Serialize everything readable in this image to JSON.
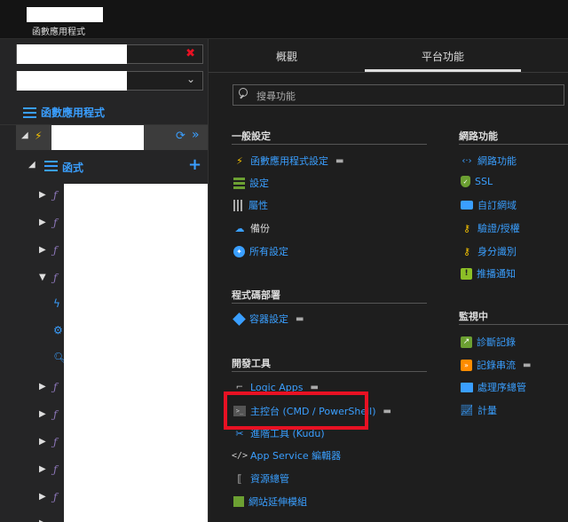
{
  "topbar": {
    "subtitle": "函數應用程式"
  },
  "left": {
    "title": "函數應用程式",
    "functions_label": "函式",
    "x_icon": "close-icon",
    "chevron": "chevron-down-icon"
  },
  "tabs": [
    {
      "label": "概觀"
    },
    {
      "label": "平台功能"
    }
  ],
  "search": {
    "placeholder": "搜尋功能"
  },
  "sections": {
    "general": {
      "title": "一般設定",
      "items": [
        {
          "label": "函數應用程式設定",
          "icon": "bolt-icon",
          "pinned": true
        },
        {
          "label": "設定",
          "icon": "settings-icon"
        },
        {
          "label": "屬性",
          "icon": "properties-icon"
        },
        {
          "label": "備份",
          "icon": "backup-icon"
        },
        {
          "label": "所有設定",
          "icon": "all-settings-icon"
        }
      ]
    },
    "code_deploy": {
      "title": "程式碼部署",
      "items": [
        {
          "label": "容器設定",
          "icon": "container-icon",
          "pinned": true
        }
      ]
    },
    "dev_tools": {
      "title": "開發工具",
      "items": [
        {
          "label": "Logic Apps",
          "icon": "logic-apps-icon",
          "pinned": true
        },
        {
          "label": "主控台 (CMD / PowerShell)",
          "icon": "console-icon",
          "pinned": true
        },
        {
          "label": "進階工具 (Kudu)",
          "icon": "kudu-icon"
        },
        {
          "label": "App Service 編輯器",
          "icon": "code-icon"
        },
        {
          "label": "資源總管",
          "icon": "resource-explorer-icon"
        },
        {
          "label": "網站延伸模組",
          "icon": "extensions-icon"
        }
      ]
    },
    "networking": {
      "title": "網路功能",
      "items": [
        {
          "label": "網路功能",
          "icon": "network-icon"
        },
        {
          "label": "SSL",
          "icon": "ssl-icon"
        },
        {
          "label": "自訂網域",
          "icon": "domain-icon"
        },
        {
          "label": "驗證/授權",
          "icon": "auth-key-icon"
        },
        {
          "label": "身分識別",
          "icon": "identity-key-icon"
        },
        {
          "label": "推播通知",
          "icon": "push-icon"
        }
      ]
    },
    "monitoring": {
      "title": "監視中",
      "items": [
        {
          "label": "診斷記錄",
          "icon": "diagnostics-icon"
        },
        {
          "label": "記錄串流",
          "icon": "log-stream-icon",
          "pinned": true
        },
        {
          "label": "處理序總管",
          "icon": "process-explorer-icon"
        },
        {
          "label": "計量",
          "icon": "metrics-icon"
        }
      ]
    }
  },
  "colors": {
    "accent": "#3a9fff",
    "highlight": "#e81123",
    "bolt": "#f5c200"
  }
}
